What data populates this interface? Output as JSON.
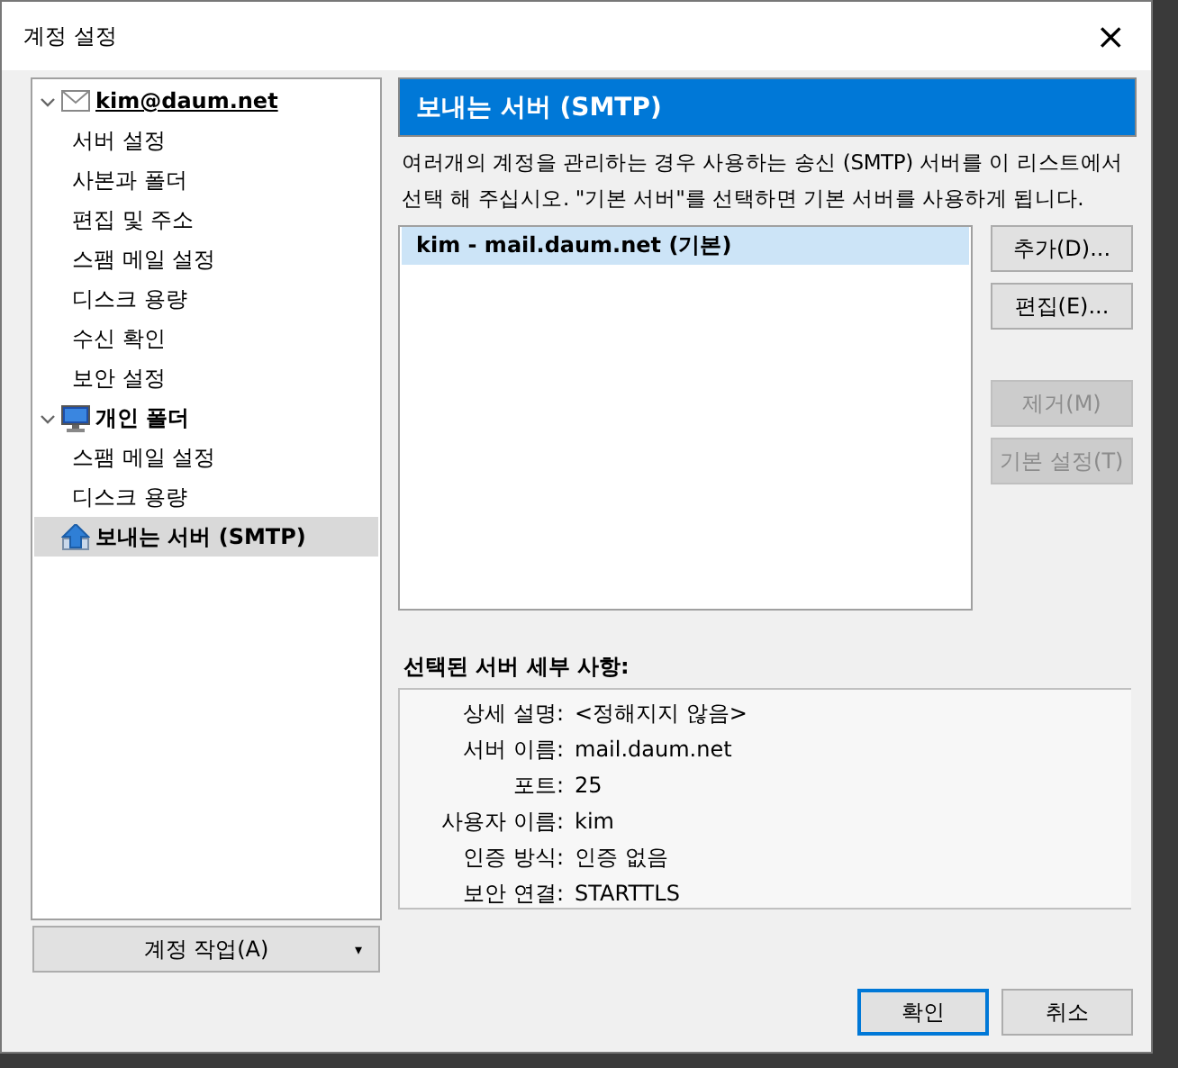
{
  "window": {
    "title": "계정 설정",
    "close": "×"
  },
  "sidebar": {
    "items": [
      {
        "label": "kim@daum.net",
        "kind": "mail",
        "expanded": true,
        "selected": false,
        "children": [
          {
            "label": "서버 설정",
            "selected": false
          },
          {
            "label": "사본과 폴더",
            "selected": false
          },
          {
            "label": "편집 및 주소",
            "selected": false
          },
          {
            "label": "스팸 메일 설정",
            "selected": false
          },
          {
            "label": "디스크 용량",
            "selected": false
          },
          {
            "label": "수신 확인",
            "selected": false
          },
          {
            "label": "보안 설정",
            "selected": false
          }
        ]
      },
      {
        "label": "개인 폴더",
        "kind": "local",
        "expanded": true,
        "selected": false,
        "children": [
          {
            "label": "스팸 메일 설정",
            "selected": false
          },
          {
            "label": "디스크 용량",
            "selected": false
          }
        ]
      },
      {
        "label": "보내는 서버 (SMTP)",
        "kind": "smtp",
        "selected": true
      }
    ],
    "account_actions": {
      "label": "계정 작업(A)",
      "caret": "▾"
    }
  },
  "panel": {
    "heading": "보내는 서버 (SMTP)",
    "description": "여러개의 계정을 관리하는 경우 사용하는 송신 (SMTP) 서버를 이 리스트에서 선택 해 주십시오. \"기본 서버\"를 선택하면 기본 서버를 사용하게 됩니다.",
    "servers": [
      {
        "label": "kim - mail.daum.net (기본)",
        "selected": true
      }
    ],
    "buttons": [
      {
        "label": "추가(D)...",
        "disabled": false
      },
      {
        "label": "편집(E)...",
        "disabled": false
      },
      {
        "label": "제거(M)",
        "disabled": true
      },
      {
        "label": "기본 설정(T)",
        "disabled": true
      }
    ],
    "details_title": "선택된 서버 세부 사항:",
    "details": [
      {
        "label": "상세 설명:",
        "value": "<정해지지 않음>"
      },
      {
        "label": "서버 이름:",
        "value": "mail.daum.net"
      },
      {
        "label": "포트:",
        "value": "25"
      },
      {
        "label": "사용자 이름:",
        "value": "kim"
      },
      {
        "label": "인증 방식:",
        "value": "인증 없음"
      },
      {
        "label": "보안 연결:",
        "value": "STARTTLS"
      }
    ]
  },
  "footer": {
    "buttons": [
      {
        "label": "확인",
        "default": true
      },
      {
        "label": "취소",
        "default": false
      }
    ]
  }
}
